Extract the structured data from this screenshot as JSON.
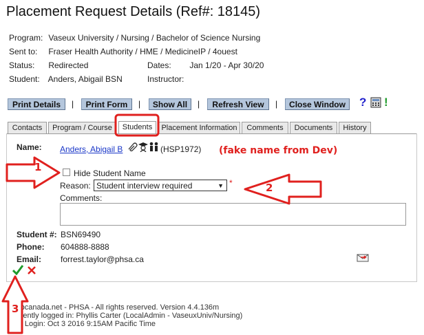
{
  "page_title": "Placement Request Details (Ref#: 18145)",
  "info": {
    "program_label": "Program:",
    "program_value": "Vaseux University / Nursing / Bachelor of Science Nursing",
    "sent_to_label": "Sent to:",
    "sent_to_value": "Fraser Health Authority / HME / MedicineIP / 4ouest",
    "status_label": "Status:",
    "status_value": "Redirected",
    "dates_label": "Dates:",
    "dates_value": "Jan 1/20 - Apr 30/20",
    "student_label": "Student:",
    "student_value": "Anders, Abigail BSN",
    "instructor_label": "Instructor:",
    "instructor_value": ""
  },
  "toolbar": {
    "print_details": "Print Details",
    "print_form": "Print Form",
    "show_all": "Show All",
    "refresh_view": "Refresh View",
    "close_window": "Close Window",
    "separator": "|",
    "help": "?",
    "alert": "!"
  },
  "tabs": [
    {
      "label": "Contacts"
    },
    {
      "label": "Program / Course"
    },
    {
      "label": "Students"
    },
    {
      "label": "Placement Information"
    },
    {
      "label": "Comments"
    },
    {
      "label": "Documents"
    },
    {
      "label": "History"
    }
  ],
  "active_tab": "Students",
  "student_panel": {
    "name_label": "Name:",
    "name_value": "Anders, Abigail B",
    "hsp_id": "(HSP1972)",
    "hide_name_label": "Hide Student Name",
    "hide_name_checked": false,
    "reason_label": "Reason:",
    "reason_value": "Student interview required",
    "required_marker": "*",
    "comments_label": "Comments:",
    "comments_value": "",
    "student_no_label": "Student #:",
    "student_no_value": "BSN69490",
    "phone_label": "Phone:",
    "phone_value": "604888-8888",
    "email_label": "Email:",
    "email_value": "forrest.taylor@phsa.ca"
  },
  "annotations": {
    "fake_note": "(fake name from Dev)",
    "n1": "1",
    "n2": "2",
    "n3": "3"
  },
  "footer": {
    "line1": "hspcanada.net - PHSA - All rights reserved.    Version 4.4.136m",
    "line2": "Currently logged in:  Phyllis Carter (LocalAdmin - VaseuxUniv/Nursing)",
    "line3": "Last Login: Oct  3 2016  9:15AM Pacific Time"
  },
  "colors": {
    "accent_red": "#e0201e",
    "link_blue": "#1a37c8",
    "button_blue": "#b4c6dc",
    "save_green": "#1e9a2a"
  }
}
